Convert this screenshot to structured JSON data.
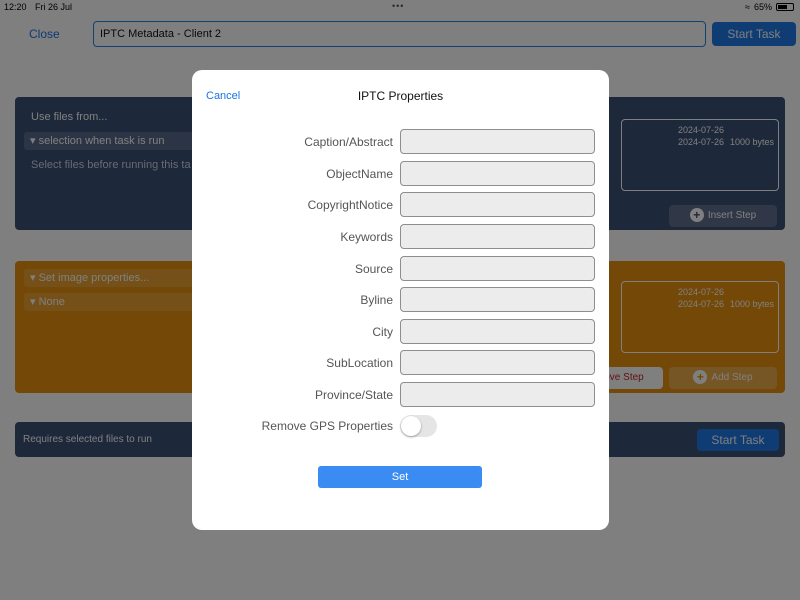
{
  "statusbar": {
    "time": "12:20",
    "date": "Fri 26 Jul",
    "battery": "65%",
    "battery_level": 0.65
  },
  "topbar": {
    "close_label": "Close",
    "title_value": "IPTC Metadata - Client 2",
    "start_task_label": "Start Task"
  },
  "source_panel": {
    "label": "Use files from...",
    "selection": "selection when task is run",
    "hint": "Select files before running this ta",
    "files": [
      {
        "date": "2024-07-26",
        "size": ""
      },
      {
        "date": "2024-07-26",
        "size": "1000 bytes"
      }
    ],
    "insert_step_label": "Insert Step"
  },
  "action_panel": {
    "action": "Set image properties...",
    "option": "None",
    "files": [
      {
        "date": "2024-07-26",
        "size": ""
      },
      {
        "date": "2024-07-26",
        "size": "1000 bytes"
      }
    ],
    "remove_step_label": "ove Step",
    "add_step_label": "Add Step"
  },
  "run_panel": {
    "text": "Requires selected files to run",
    "start_task_label": "Start Task"
  },
  "modal": {
    "cancel_label": "Cancel",
    "title": "IPTC Properties",
    "fields": [
      {
        "label": "Caption/Abstract",
        "value": ""
      },
      {
        "label": "ObjectName",
        "value": ""
      },
      {
        "label": "CopyrightNotice",
        "value": ""
      },
      {
        "label": "Keywords",
        "value": ""
      },
      {
        "label": "Source",
        "value": ""
      },
      {
        "label": "Byline",
        "value": ""
      },
      {
        "label": "City",
        "value": ""
      },
      {
        "label": "SubLocation",
        "value": ""
      },
      {
        "label": "Province/State",
        "value": ""
      }
    ],
    "gps_label": "Remove GPS Properties",
    "gps_enabled": false,
    "set_label": "Set"
  },
  "colors": {
    "accent": "#1e7ae6",
    "panel_blue": "#3d5176",
    "panel_orange": "#e8920f"
  }
}
